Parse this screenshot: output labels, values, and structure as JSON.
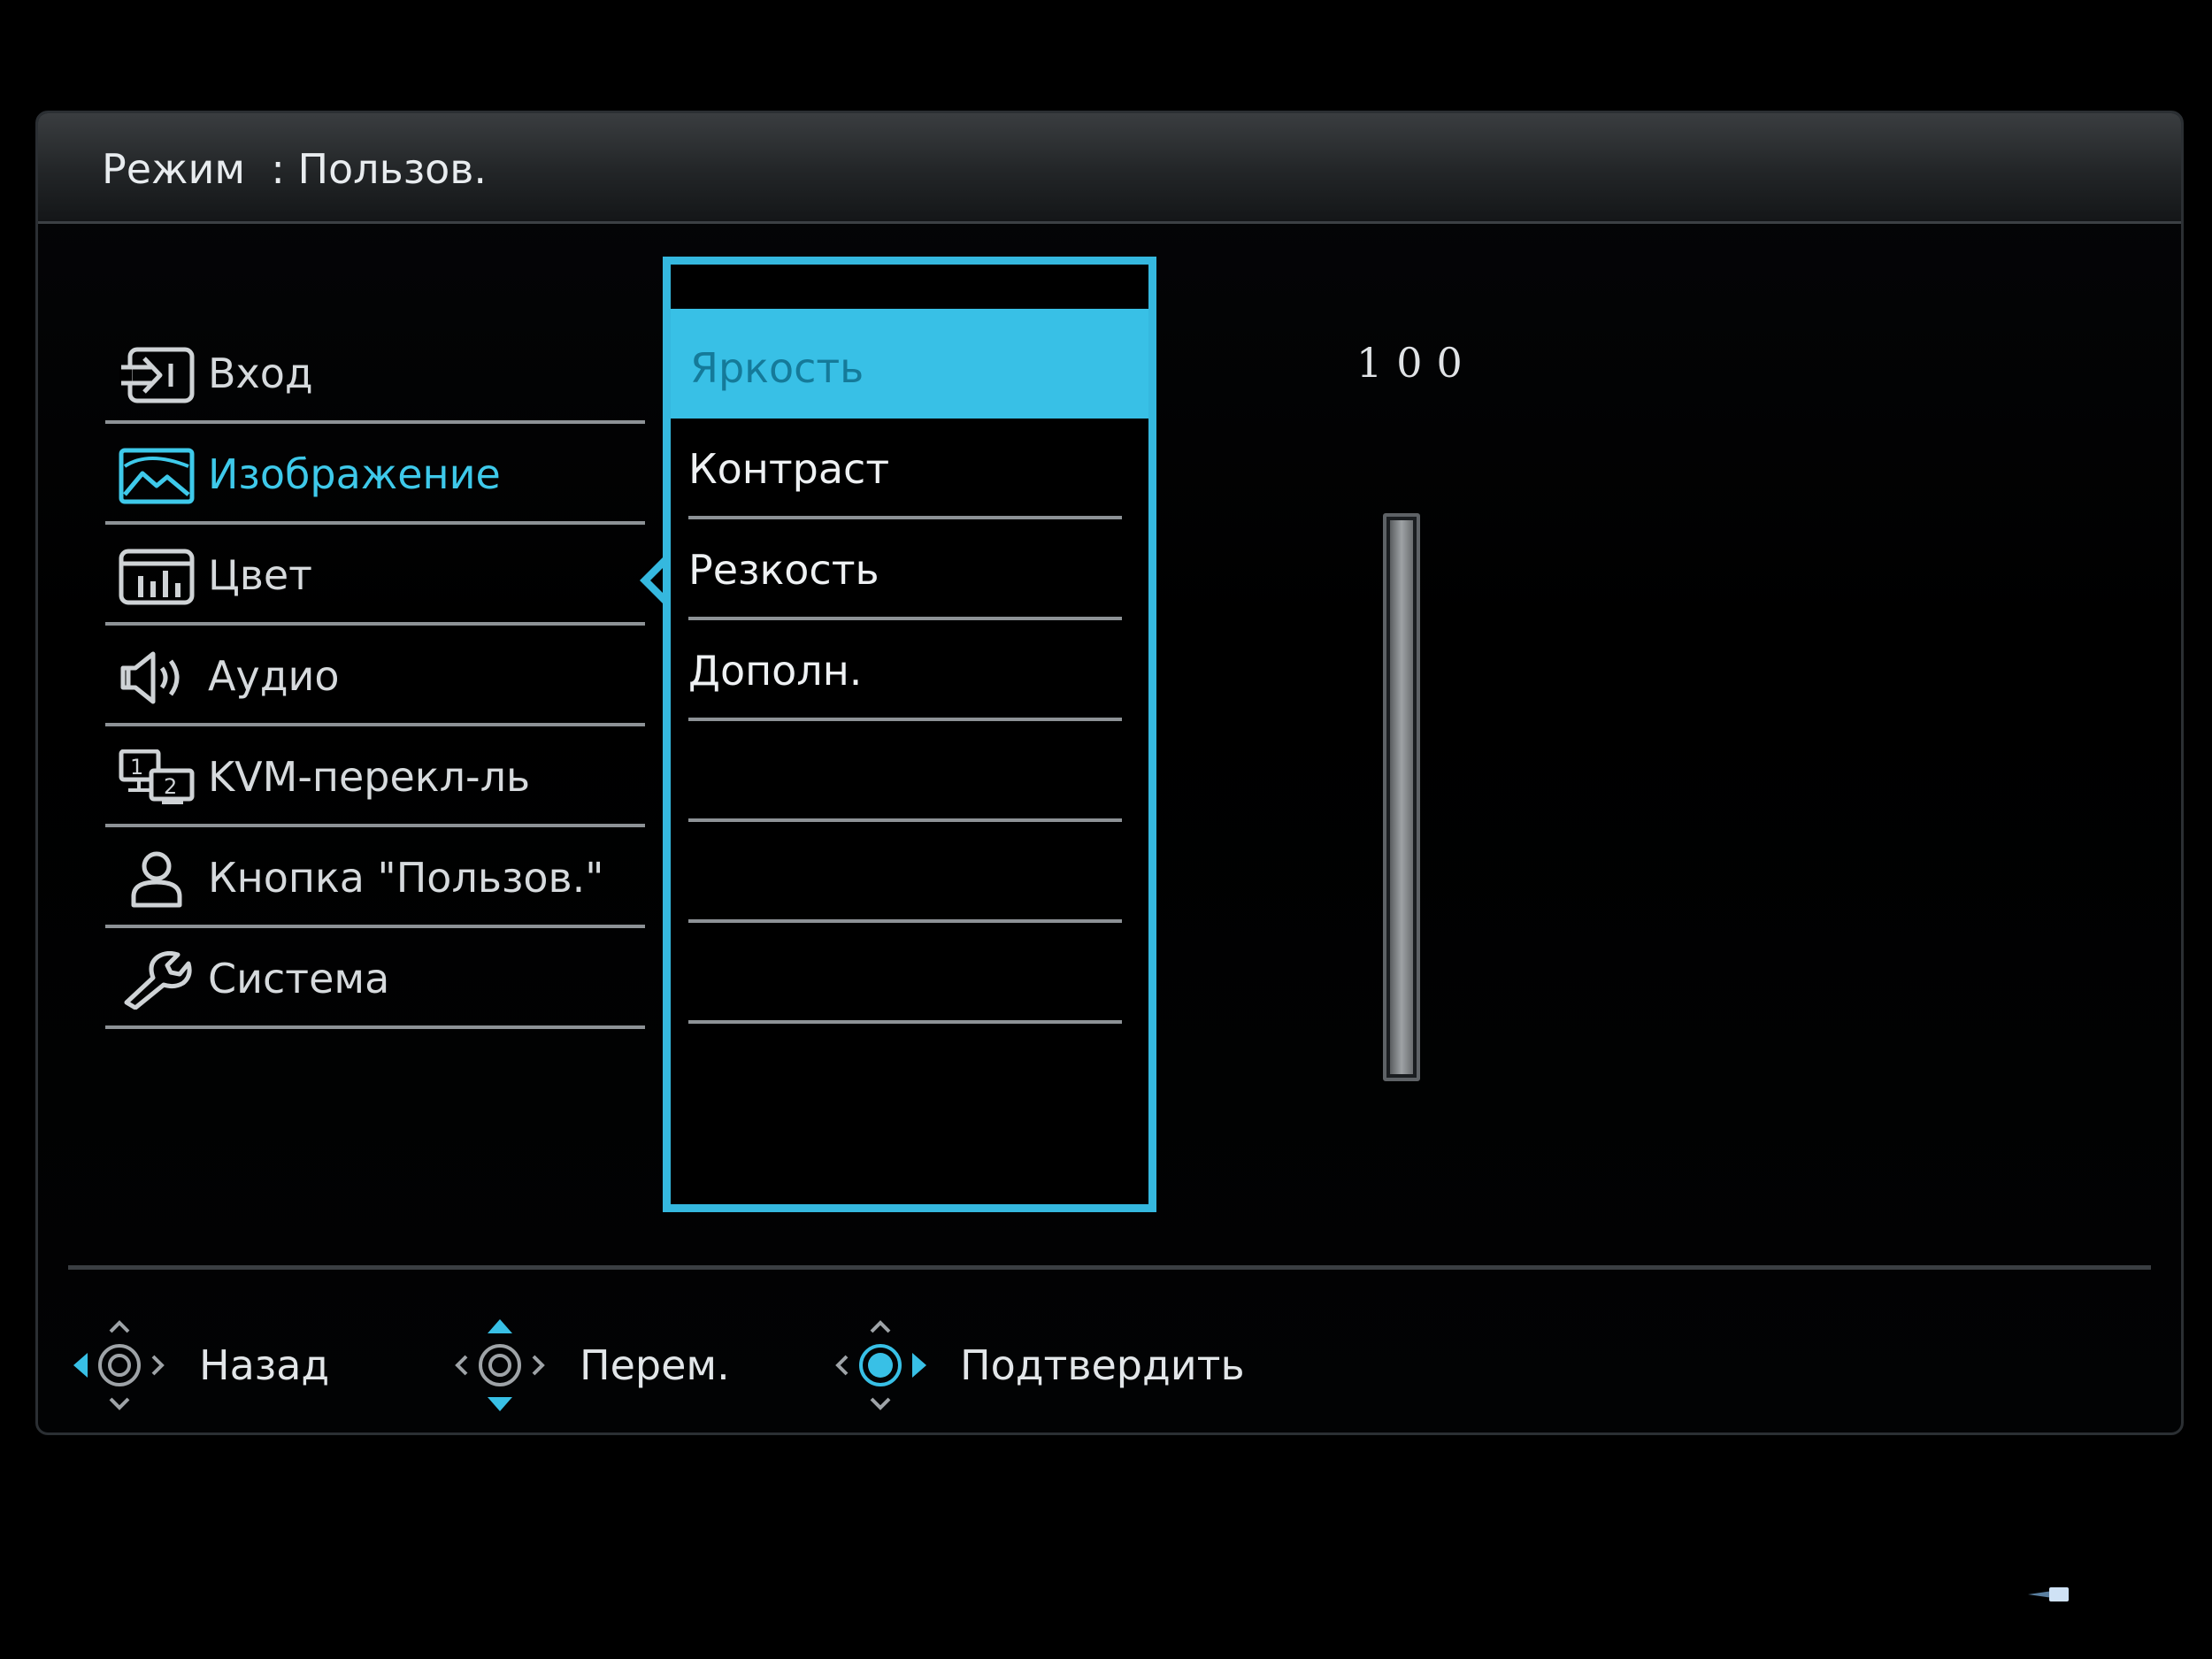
{
  "header": {
    "title": "Режим  : Пользов."
  },
  "menu": {
    "items": [
      {
        "label": "Вход",
        "icon": "input-icon",
        "active": false
      },
      {
        "label": "Изображение",
        "icon": "picture-icon",
        "active": true
      },
      {
        "label": "Цвет",
        "icon": "color-icon",
        "active": false
      },
      {
        "label": "Аудио",
        "icon": "speaker-icon",
        "active": false
      },
      {
        "label": "KVM-перекл-ль",
        "icon": "kvm-switch-icon",
        "active": false
      },
      {
        "label": "Кнопка \"Пользов.\"",
        "icon": "user-icon",
        "active": false
      },
      {
        "label": "Система",
        "icon": "wrench-icon",
        "active": false
      }
    ]
  },
  "submenu": {
    "items": [
      {
        "label": "Яркость",
        "selected": true
      },
      {
        "label": "Контраст",
        "selected": false
      },
      {
        "label": "Резкость",
        "selected": false
      },
      {
        "label": "Дополн.",
        "selected": false
      },
      {
        "label": "",
        "selected": false
      },
      {
        "label": "",
        "selected": false
      },
      {
        "label": "",
        "selected": false
      }
    ]
  },
  "adjust": {
    "value_text": "100",
    "level_percent": 100
  },
  "footer": {
    "hints": [
      {
        "label": "Назад",
        "icon": "joystick-left-icon"
      },
      {
        "label": "Перем.",
        "icon": "joystick-updown-icon"
      },
      {
        "label": "Подтвердить",
        "icon": "joystick-press-icon"
      }
    ]
  },
  "colors": {
    "accent": "#38c0e6",
    "text": "#e2e6e9",
    "divider": "#8d9296",
    "background": "#000000"
  }
}
